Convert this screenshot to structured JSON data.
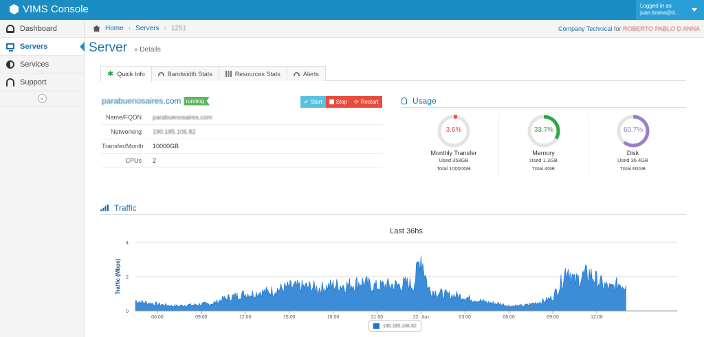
{
  "app": {
    "title": "VIMS Console"
  },
  "user": {
    "logged_in_label": "Logged in as",
    "email": "juan.brana@d..."
  },
  "sidebar": {
    "items": [
      {
        "label": "Dashboard"
      },
      {
        "label": "Servers"
      },
      {
        "label": "Services"
      },
      {
        "label": "Support"
      }
    ],
    "collapse_glyph": "«"
  },
  "breadcrumb": {
    "home": "Home",
    "servers": "Servers",
    "server_id": "1251",
    "sep": "›"
  },
  "company": {
    "name": "Company Technical",
    "for": "for",
    "customer": "ROBERTO PABLO D ANNA"
  },
  "page": {
    "title": "Server",
    "subtitle": "» Details"
  },
  "tabs": [
    {
      "label": "Quick Info"
    },
    {
      "label": "Bandwidth Stats"
    },
    {
      "label": "Resources Stats"
    },
    {
      "label": "Alerts"
    }
  ],
  "server": {
    "name_prefix": "parabuenosaires",
    "name_suffix": ".com",
    "status": "running",
    "actions": {
      "start": "Start",
      "stop": "Stop",
      "restart": "Restart"
    },
    "details": [
      {
        "key": "Name/FQDN",
        "value": "parabuenosaires.com"
      },
      {
        "key": "Networking",
        "value": "190.185.106.82"
      },
      {
        "key": "Transfer/Month",
        "value": "10000GB"
      },
      {
        "key": "CPUs",
        "value": "2"
      }
    ]
  },
  "usage": {
    "title": "Usage",
    "gauges": [
      {
        "percent_label": "3.6%",
        "fraction": 0.036,
        "color": "#e74c3c",
        "label": "Monthly Transfer",
        "used": "Used 358GB",
        "total": "Total 10000GB"
      },
      {
        "percent_label": "33.7%",
        "fraction": 0.337,
        "color": "#2ba84a",
        "label": "Memory",
        "used": "Used 1.3GB",
        "total": "Total 4GB"
      },
      {
        "percent_label": "60.7%",
        "fraction": 0.607,
        "color": "#9b7fc4",
        "label": "Disk",
        "used": "Used 36.4GB",
        "total": "Total 60GB"
      }
    ]
  },
  "traffic": {
    "title": "Traffic",
    "legend": "190.185.106.82"
  },
  "chart_data": {
    "type": "area",
    "title": "Last 36hs",
    "ylabel": "Traffic (Mbps)",
    "xlabel": "",
    "ylim": [
      0,
      4
    ],
    "yticks": [
      0,
      2,
      4
    ],
    "xlim": [
      4.5,
      41.5
    ],
    "xticks": [
      {
        "x": 6,
        "label": "06:00"
      },
      {
        "x": 9,
        "label": "09:00"
      },
      {
        "x": 12,
        "label": "12:00"
      },
      {
        "x": 15,
        "label": "15:00"
      },
      {
        "x": 18,
        "label": "18:00"
      },
      {
        "x": 21,
        "label": "21:00"
      },
      {
        "x": 24,
        "label": "22. Jun"
      },
      {
        "x": 27,
        "label": "03:00"
      },
      {
        "x": 30,
        "label": "06:00"
      },
      {
        "x": 33,
        "label": "09:00"
      },
      {
        "x": 36,
        "label": "12:00"
      }
    ],
    "grid": true,
    "legend_position": "bottom-center",
    "series": [
      {
        "color": "#1b78d0",
        "x": [
          4.5,
          5,
          5.5,
          6,
          6.5,
          7,
          7.5,
          8,
          8.5,
          9,
          9.5,
          10,
          10.5,
          11,
          11.5,
          12,
          12.5,
          13,
          13.5,
          14,
          14.5,
          15,
          15.5,
          16,
          16.5,
          17,
          17.5,
          18,
          18.5,
          19,
          19.5,
          20,
          20.5,
          21,
          21.5,
          22,
          22.5,
          23,
          23.5,
          24,
          24.5,
          25,
          25.5,
          26,
          26.5,
          27,
          27.5,
          28,
          28.5,
          29,
          29.5,
          30,
          30.5,
          31,
          31.5,
          32,
          32.5,
          33,
          33.5,
          34,
          34.5,
          35,
          35.5,
          36,
          36.5,
          37,
          37.5,
          38
        ],
        "y": [
          0.6,
          0.5,
          0.45,
          0.4,
          0.35,
          0.3,
          0.3,
          0.35,
          0.35,
          0.4,
          0.4,
          0.5,
          0.7,
          0.8,
          0.9,
          1.0,
          1.0,
          1.1,
          1.1,
          1.2,
          1.3,
          1.4,
          1.4,
          1.4,
          1.4,
          1.3,
          1.4,
          1.5,
          1.5,
          1.5,
          1.6,
          1.7,
          1.5,
          1.4,
          1.5,
          1.5,
          1.5,
          1.6,
          1.5,
          3.3,
          1.3,
          1.1,
          1.0,
          0.9,
          0.9,
          0.8,
          0.7,
          0.6,
          0.5,
          0.45,
          0.4,
          0.3,
          0.3,
          0.3,
          0.4,
          0.5,
          0.6,
          0.8,
          1.5,
          2.6,
          1.7,
          2.0,
          2.2,
          1.8,
          1.5,
          1.3,
          1.6,
          1.5
        ]
      }
    ]
  }
}
